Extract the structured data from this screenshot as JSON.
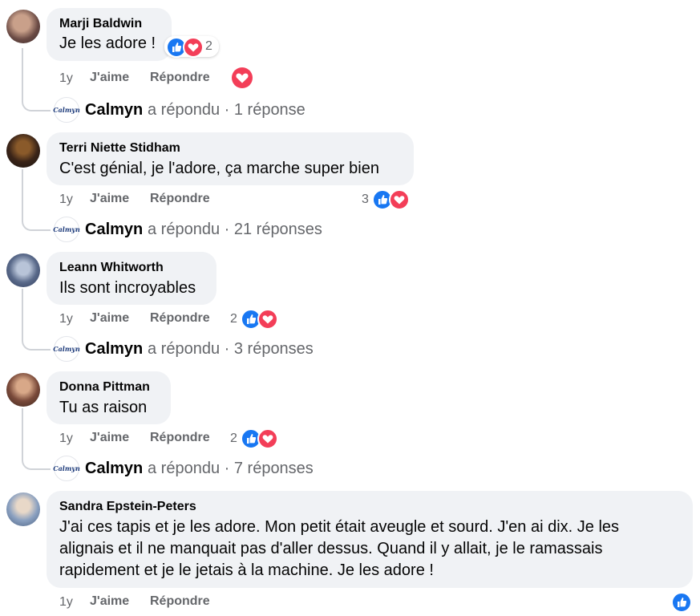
{
  "comments": [
    {
      "author": "Marji Baldwin",
      "text": "Je les adore !",
      "time": "1y",
      "like_label": "J'aime",
      "reply_label": "Répondre",
      "reaction_count": "2",
      "reply_author": "Calmyn",
      "reply_summary": "a répondu · 1 réponse"
    },
    {
      "author": "Terri Niette Stidham",
      "text": "C'est génial, je l'adore, ça marche super bien",
      "time": "1y",
      "like_label": "J'aime",
      "reply_label": "Répondre",
      "reaction_count": "3",
      "reply_author": "Calmyn",
      "reply_summary": "a répondu · 21 réponses"
    },
    {
      "author": "Leann Whitworth",
      "text": "Ils sont incroyables",
      "time": "1y",
      "like_label": "J'aime",
      "reply_label": "Répondre",
      "reaction_count": "2",
      "reply_author": "Calmyn",
      "reply_summary": "a répondu · 3 réponses"
    },
    {
      "author": "Donna Pittman",
      "text": "Tu as raison",
      "time": "1y",
      "like_label": "J'aime",
      "reply_label": "Répondre",
      "reaction_count": "2",
      "reply_author": "Calmyn",
      "reply_summary": "a répondu · 7 réponses"
    },
    {
      "author": "Sandra Epstein-Peters",
      "text_lines": [
        "J'ai ces tapis et je les adore. Mon petit était aveugle et sourd. J'en ai dix. Je les",
        "alignais et il ne manquait pas d'aller dessus. Quand il y allait, je le ramassais",
        "rapidement et je le jetais à la machine. Je les adore !"
      ],
      "time": "1y",
      "like_label": "J'aime",
      "reply_label": "Répondre"
    }
  ],
  "brand_logo_text": "Calmyn",
  "colors": {
    "bubble": "#f0f2f5",
    "meta_text": "#65676b",
    "like_blue": "#1877f2",
    "love_red": "#f33e58"
  },
  "icons": {
    "like": "thumbs-up-icon",
    "love": "heart-icon"
  }
}
